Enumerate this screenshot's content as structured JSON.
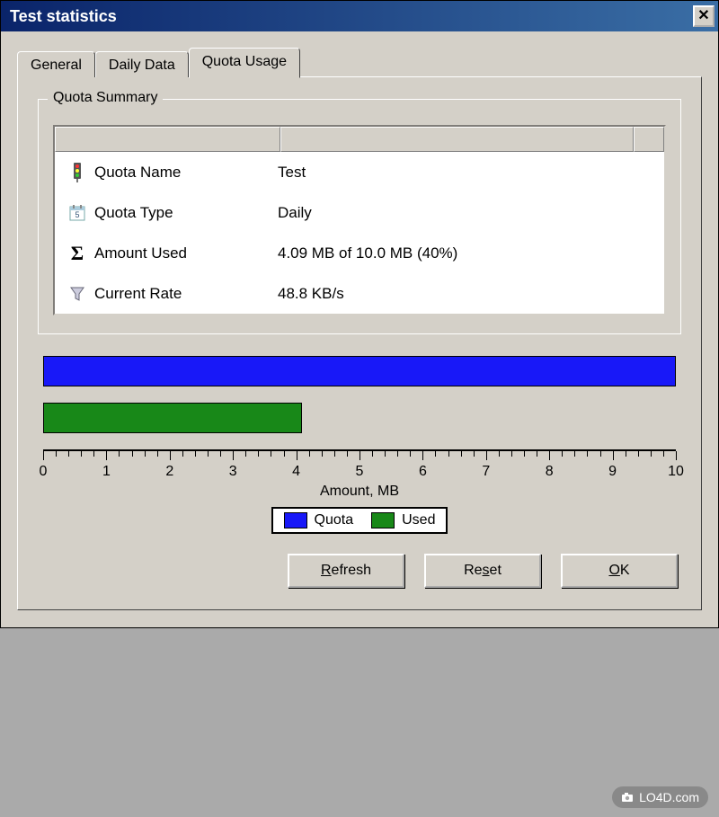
{
  "window": {
    "title": "Test statistics"
  },
  "tabs": {
    "general": "General",
    "daily": "Daily Data",
    "quota": "Quota Usage"
  },
  "group": {
    "label": "Quota Summary"
  },
  "rows": {
    "quota_name": {
      "label": "Quota Name",
      "value": "Test"
    },
    "quota_type": {
      "label": "Quota Type",
      "value": "Daily"
    },
    "amount_used": {
      "label": "Amount Used",
      "value": "4.09 MB of 10.0 MB (40%)"
    },
    "current_rate": {
      "label": "Current Rate",
      "value": "48.8 KB/s"
    }
  },
  "chart_data": {
    "type": "bar",
    "categories": [
      "Quota",
      "Used"
    ],
    "values": [
      10.0,
      4.09
    ],
    "xlabel": "Amount, MB",
    "ylabel": "",
    "ylim": [
      0,
      10
    ],
    "ticks": [
      0,
      1,
      2,
      3,
      4,
      5,
      6,
      7,
      8,
      9,
      10
    ],
    "legend": [
      "Quota",
      "Used"
    ],
    "colors": {
      "Quota": "#1818f8",
      "Used": "#188818"
    }
  },
  "buttons": {
    "refresh": "Refresh",
    "reset": "Reset",
    "ok": "OK"
  },
  "watermark": "LO4D.com"
}
